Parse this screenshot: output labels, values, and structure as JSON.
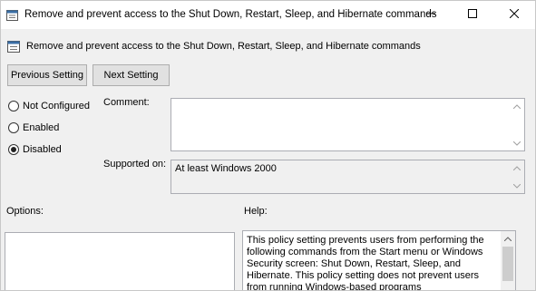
{
  "window": {
    "title": "Remove and prevent access to the Shut Down, Restart, Sleep, and Hibernate commands"
  },
  "header": {
    "policy_name": "Remove and prevent access to the Shut Down, Restart, Sleep, and Hibernate commands"
  },
  "navigation": {
    "previous_label": "Previous Setting",
    "next_label": "Next Setting"
  },
  "state": {
    "options": [
      {
        "label": "Not Configured",
        "checked": false
      },
      {
        "label": "Enabled",
        "checked": false
      },
      {
        "label": "Disabled",
        "checked": true
      }
    ]
  },
  "comment": {
    "label": "Comment:",
    "value": ""
  },
  "supported": {
    "label": "Supported on:",
    "value": "At least Windows 2000"
  },
  "options_section": {
    "label": "Options:"
  },
  "help_section": {
    "label": "Help:",
    "text": "This policy setting prevents users from performing the following commands from the Start menu or Windows Security screen: Shut Down, Restart, Sleep, and Hibernate. This policy setting does not prevent users from running Windows-based programs"
  },
  "colors": {
    "window_bg": "#f0f0f0",
    "titlebar_bg": "#ffffff",
    "button_bg": "#e1e1e1",
    "button_border": "#adadad",
    "field_border": "#abadb3"
  },
  "icons": {
    "title_icon": "policy-settings-icon",
    "header_icon": "policy-settings-icon",
    "minimize": "minimize-icon",
    "maximize": "maximize-icon",
    "close": "close-icon"
  }
}
